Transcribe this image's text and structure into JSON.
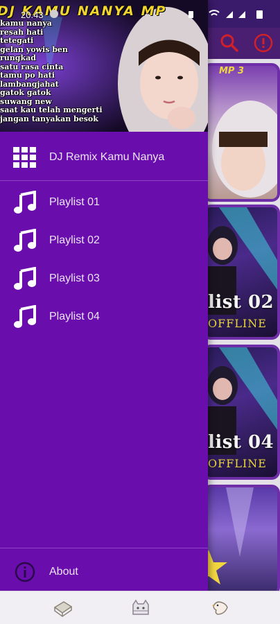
{
  "status_bar": {
    "time": "20.43"
  },
  "drawer": {
    "header": {
      "title": "DJ KAMU NANYA MP",
      "lyrics": [
        "kamu nanya",
        "resah hati",
        "tetegati",
        "gelan yowis ben",
        "rungkad",
        "satu rasa cinta",
        "tamu po hati",
        "lambangjahat",
        "gatok gatok",
        "suwang new",
        "saat kau telah mengerti",
        "jangan tanyakan besok"
      ]
    },
    "app_item": {
      "label": "DJ Remix Kamu Nanya",
      "icon": "grid-icon"
    },
    "playlists": [
      {
        "label": "Playlist 01",
        "icon": "music-note-icon"
      },
      {
        "label": "Playlist 02",
        "icon": "music-note-icon"
      },
      {
        "label": "Playlist 03",
        "icon": "music-note-icon"
      },
      {
        "label": "Playlist 04",
        "icon": "music-note-icon"
      }
    ],
    "about": {
      "label": "About",
      "icon": "info-icon"
    }
  },
  "background": {
    "cards": [
      {
        "label": "",
        "sub": "MP 3"
      },
      {
        "label": "list 02",
        "sub": "OFFLINE"
      },
      {
        "label": "list 04",
        "sub": "OFFLINE"
      },
      {
        "label": "",
        "sub": ""
      }
    ]
  },
  "colors": {
    "drawer": "#6a0dad",
    "accent_red": "#d0202a",
    "title_yellow": "#f2d530"
  }
}
